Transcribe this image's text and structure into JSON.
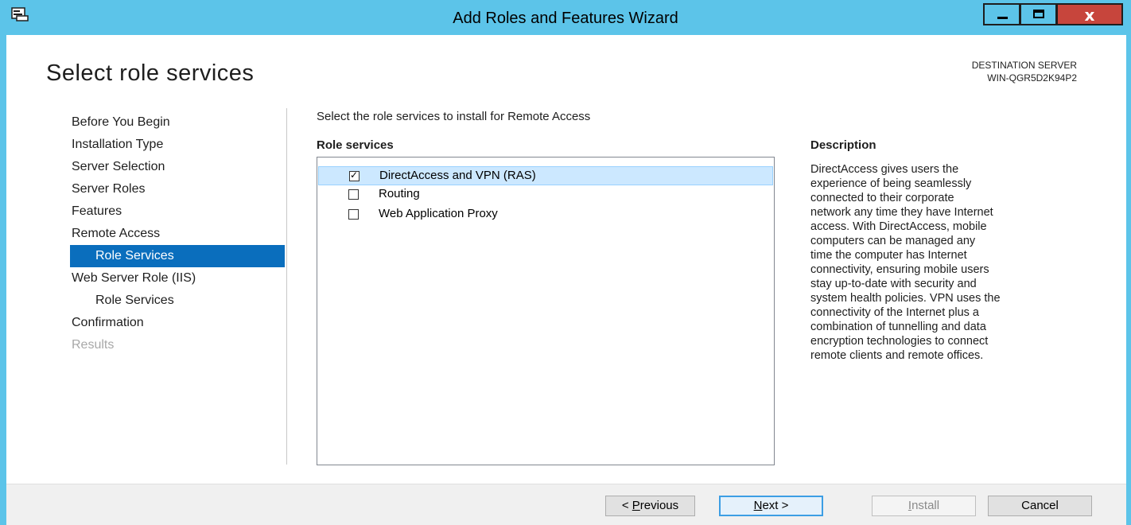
{
  "window": {
    "title": "Add Roles and Features Wizard",
    "close_glyph": "x"
  },
  "header": {
    "page_title": "Select role services",
    "destination_label": "DESTINATION SERVER",
    "destination_server": "WIN-QGR5D2K94P2"
  },
  "nav": {
    "items": [
      {
        "label": "Before You Begin",
        "state": "normal"
      },
      {
        "label": "Installation Type",
        "state": "normal"
      },
      {
        "label": "Server Selection",
        "state": "normal"
      },
      {
        "label": "Server Roles",
        "state": "normal"
      },
      {
        "label": "Features",
        "state": "normal"
      },
      {
        "label": "Remote Access",
        "state": "normal"
      },
      {
        "label": "Role Services",
        "state": "selected"
      },
      {
        "label": "Web Server Role (IIS)",
        "state": "normal"
      },
      {
        "label": "Role Services",
        "state": "normal"
      },
      {
        "label": "Confirmation",
        "state": "normal"
      },
      {
        "label": "Results",
        "state": "disabled"
      }
    ]
  },
  "main": {
    "instruction": "Select the role services to install for Remote Access",
    "role_services_header": "Role services",
    "role_services": [
      {
        "label": "DirectAccess and VPN (RAS)",
        "checked": true,
        "selected": true
      },
      {
        "label": "Routing",
        "checked": false,
        "selected": false
      },
      {
        "label": "Web Application Proxy",
        "checked": false,
        "selected": false
      }
    ],
    "description_header": "Description",
    "description_lines": [
      "DirectAccess gives users the",
      "experience of being seamlessly",
      "connected to their corporate",
      "network any time they have Internet",
      "access. With DirectAccess, mobile",
      "computers can be managed any",
      "time the computer has Internet",
      "connectivity, ensuring mobile users",
      "stay up-to-date with security and",
      "system health policies. VPN uses the",
      "connectivity of the Internet plus a",
      "combination of tunnelling and data",
      "encryption technologies to connect",
      "remote clients and remote offices."
    ]
  },
  "footer": {
    "previous": {
      "prefix": "< ",
      "mnemonic": "P",
      "rest": "revious"
    },
    "next": {
      "mnemonic": "N",
      "rest": "ext >"
    },
    "install": {
      "mnemonic": "I",
      "rest": "nstall"
    },
    "cancel": "Cancel"
  },
  "colors": {
    "title_bar": "#5cc4e9",
    "nav_selected": "#0a6ebd",
    "close_button": "#c7453c",
    "list_selection": "#cce8ff"
  }
}
